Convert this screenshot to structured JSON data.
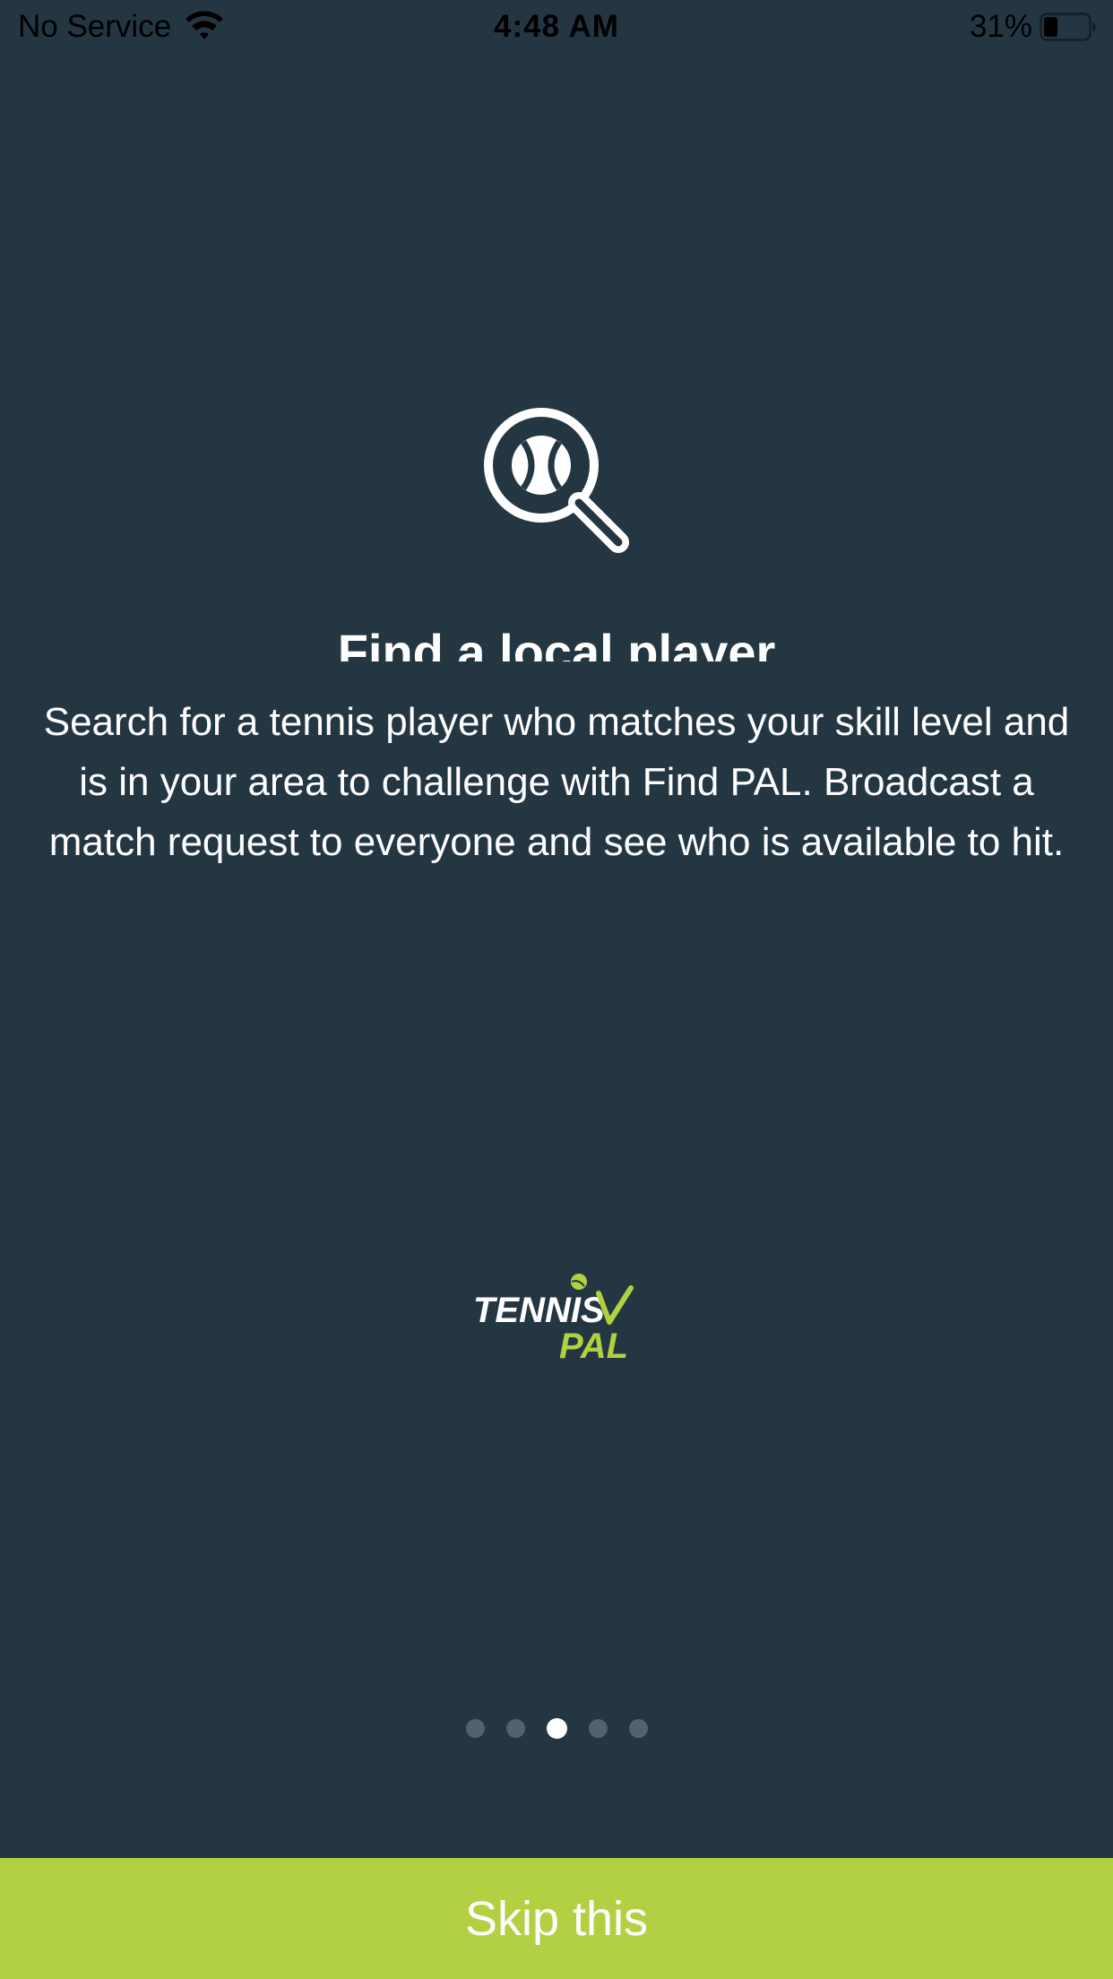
{
  "status_bar": {
    "carrier": "No Service",
    "time": "4:48 AM",
    "battery_percent": "31%",
    "battery_level": 0.31,
    "wifi_icon": "wifi-icon",
    "battery_icon": "battery-icon"
  },
  "onboarding": {
    "icon": "search-tennis-ball-icon",
    "title": "Find a local player",
    "description": "Search for a tennis player who matches your skill level and is in your area to challenge with Find PAL. Broadcast a match request to everyone and see who is available to hit."
  },
  "logo": {
    "line1": "TENNIS",
    "line2": "PAL"
  },
  "pager": {
    "total": 5,
    "current": 3
  },
  "skip_button": {
    "label": "Skip this"
  },
  "colors": {
    "background": "#253643",
    "accent": "#b1d143",
    "dot_inactive": "#53626d",
    "dot_active": "#ffffff"
  }
}
